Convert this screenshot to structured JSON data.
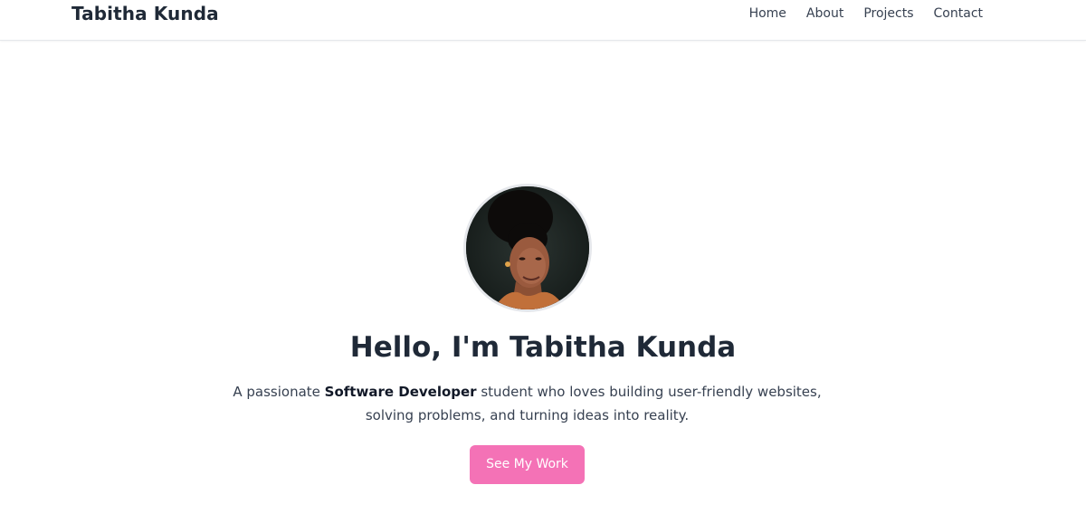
{
  "nav": {
    "brand": "Tabitha Kunda",
    "links": [
      {
        "label": "Home"
      },
      {
        "label": "About"
      },
      {
        "label": "Projects"
      },
      {
        "label": "Contact"
      }
    ]
  },
  "hero": {
    "title": "Hello, I'm Tabitha Kunda",
    "description": {
      "prefix": "A passionate ",
      "highlight": "Software Developer",
      "suffix": " student who loves building user-friendly websites, solving problems, and turning ideas into reality."
    },
    "cta_label": "See My Work"
  },
  "colors": {
    "accent": "#f472b6",
    "text_dark": "#1f2937",
    "border": "#e5e7eb"
  }
}
